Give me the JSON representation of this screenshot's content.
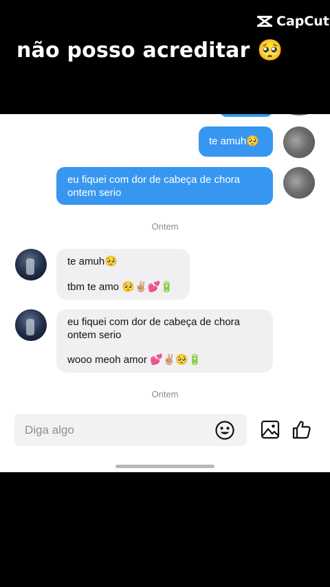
{
  "overlay": {
    "caption": "não posso acreditar 🥺",
    "watermark": "CapCut"
  },
  "messages": {
    "out1": {
      "text": "te amuh🥺"
    },
    "out2": {
      "line1": "eu fiquei com dor de cabeça de chora",
      "line2": "ontem serio"
    },
    "timestamp1": "Ontem",
    "in1": {
      "line1": "te amuh🥺",
      "line2": "tbm te amo 🥺✌🏼💕🔋"
    },
    "in2": {
      "line1": "eu fiquei com dor de cabeça de chora",
      "line2": "ontem serio",
      "line3": "wooo meoh amor 💕✌🏼🥺🔋"
    },
    "timestamp2": "Ontem"
  },
  "composer": {
    "placeholder": "Diga algo"
  },
  "icons": {
    "emoji": "smiley-icon",
    "image": "image-icon",
    "like": "thumbs-up-icon"
  },
  "colors": {
    "outgoing_bubble": "#3797f0",
    "incoming_bubble": "#f0f0f2"
  }
}
